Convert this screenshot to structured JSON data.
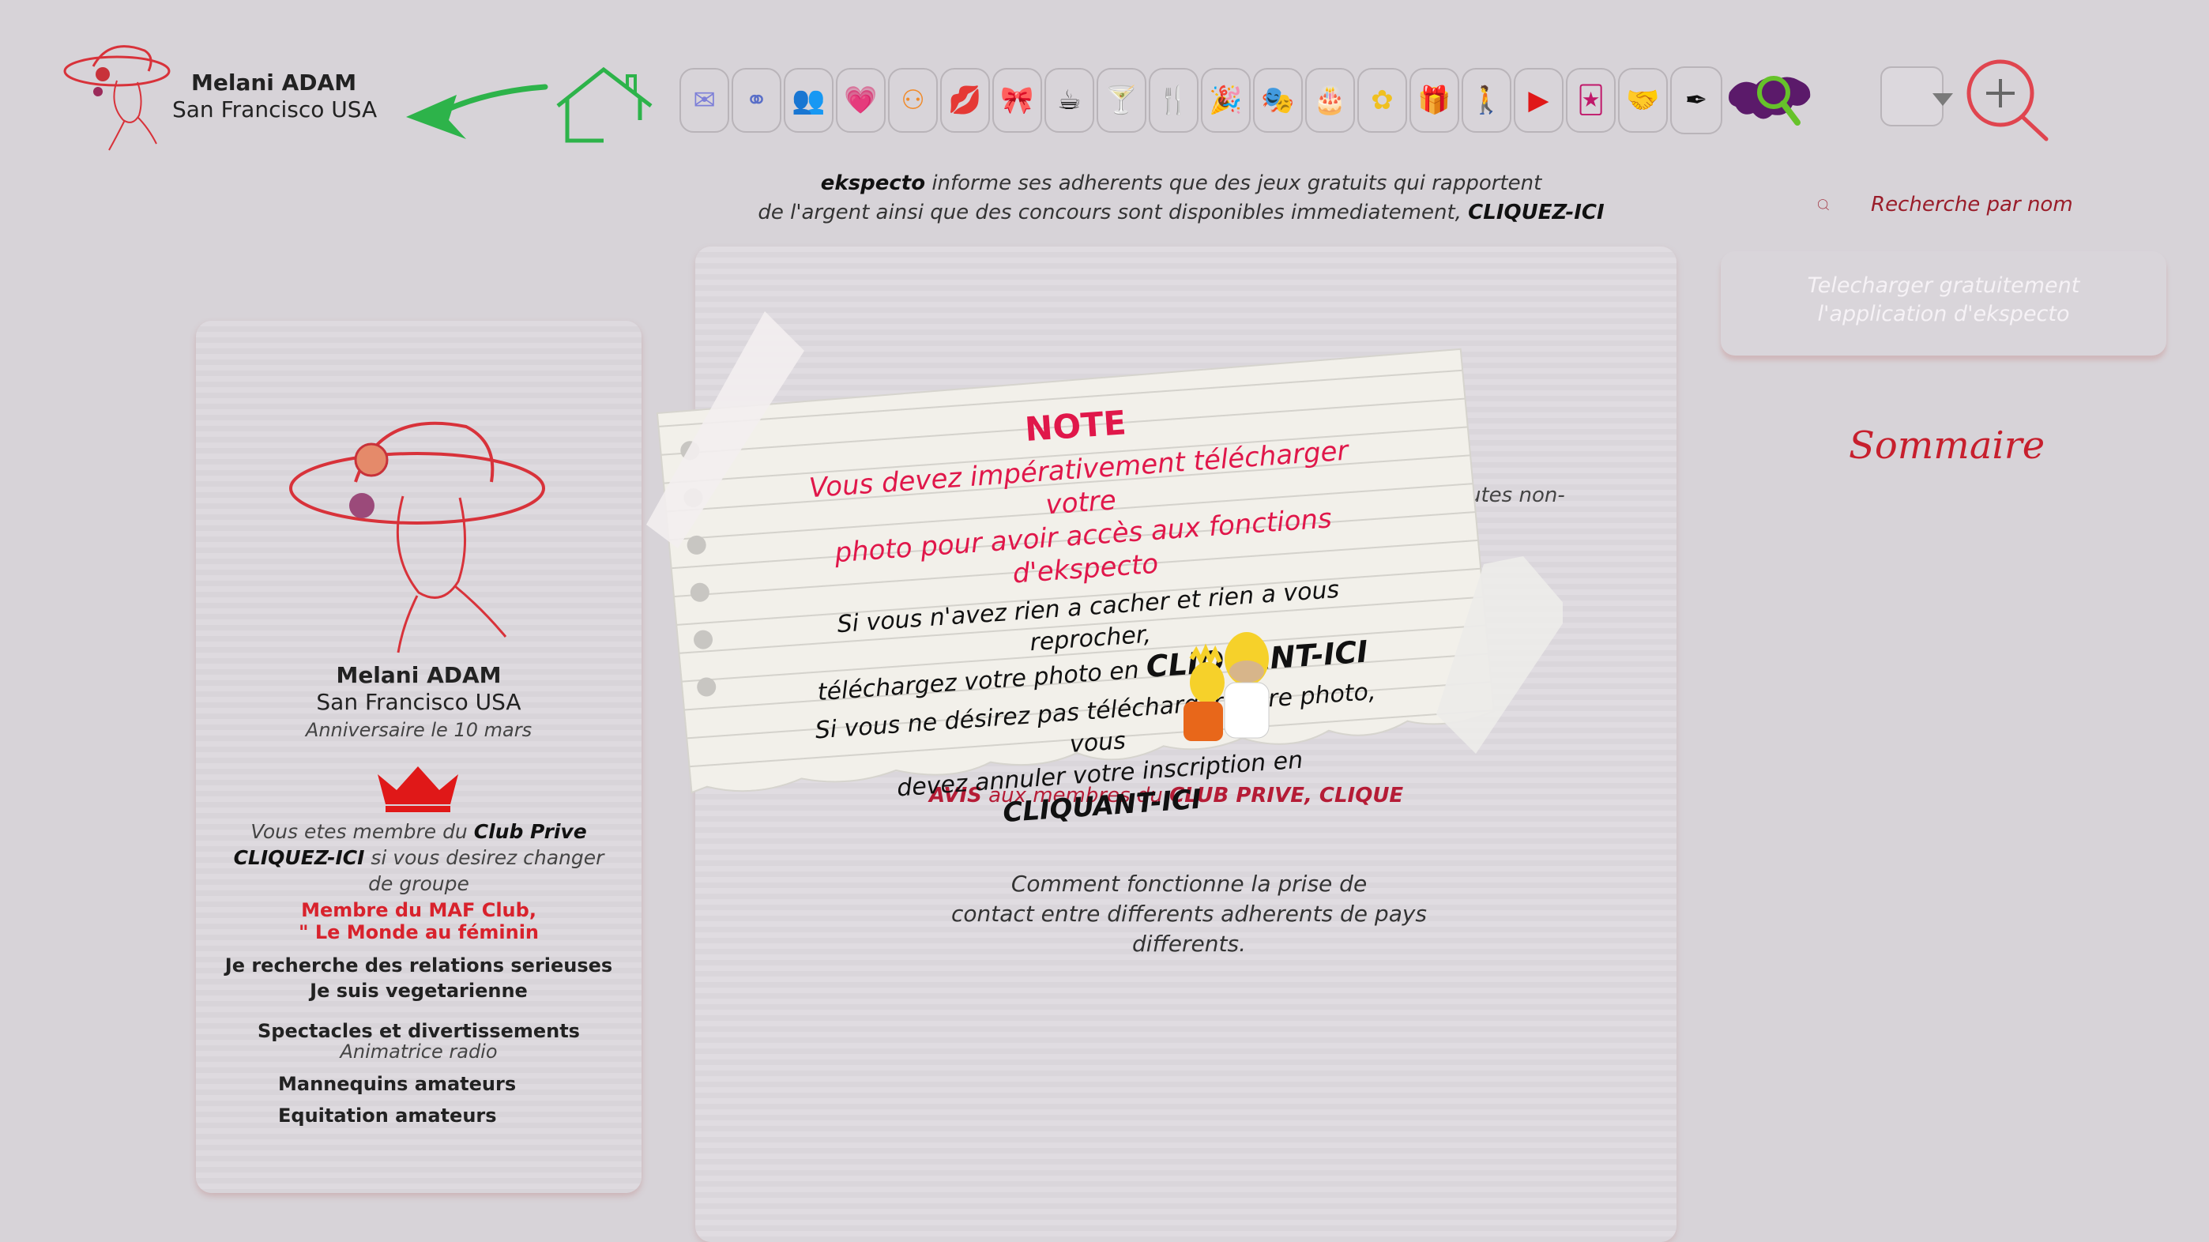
{
  "header": {
    "user_name": "Melani ADAM",
    "user_city": "San Francisco USA"
  },
  "toolbar": {
    "icons": [
      "mail-icon",
      "group-icon",
      "friends-icon",
      "hearts-icon",
      "couple-icon",
      "kiss-icon",
      "bow-icon",
      "coffee-icon",
      "cocktail-icon",
      "restaurant-icon",
      "party-icon",
      "theater-icon",
      "cake-icon",
      "flower-icon",
      "gift-icon",
      "walk-icon",
      "play-icon",
      "jester-icon",
      "handshake-icon",
      "pen-icon",
      "world-search-icon"
    ],
    "select_value": "",
    "accent_color": "#e0454f"
  },
  "info": {
    "brand": "ekspecto",
    "line1": "informe ses adherents que des jeux gratuits qui rapportent",
    "line2": "de l'argent ainsi que des concours sont disponibles  immediatement,",
    "cta": "CLIQUEZ-ICI"
  },
  "search": {
    "label": "Recherche par nom"
  },
  "download": {
    "line1": "Telecharger gratuitement",
    "line2": "l'application d'ekspecto"
  },
  "sommaire": "Sommaire",
  "profile": {
    "name": "Melani ADAM",
    "city": "San Francisco USA",
    "birthday": "Anniversaire le 10 mars",
    "club_pre": "Vous etes membre du",
    "club_name": "Club Prive",
    "club_cta": "CLIQUEZ-ICI",
    "club_post": "si vous desirez changer",
    "club_post2": "de groupe",
    "maf1": "Membre du  MAF Club,",
    "maf2": "\" Le Monde au féminin",
    "relation": "Je recherche des relations serieuses",
    "diet": "Je suis vegetarienne",
    "spectacles": "Spectacles et divertissements",
    "animatrice": "Animatrice radio",
    "mannequins": "Mannequins amateurs",
    "equitation": "Equitation amateurs"
  },
  "main": {
    "behind_text": "utes non-",
    "avis_prefix": "AVIS",
    "avis_mid": "aux membres du",
    "avis_club": "CLUB PRIVE, CLIQUE",
    "comment1": "Comment fonctionne la prise de",
    "comment2": "contact entre differents adherents de pays  differents."
  },
  "note": {
    "title": "NOTE",
    "red1": "Vous devez impérativement télécharger votre",
    "red2": "photo pour avoir accès aux fonctions d'ekspecto",
    "b1": "Si vous n'avez rien a cacher et rien a vous reprocher,",
    "b2": "téléchargez votre photo en",
    "b2_cta": "CLIQUANT-ICI",
    "b3": "Si vous ne désirez pas télécharger votre photo, vous",
    "b4": "devez annuler votre inscription en",
    "b5": "CLIQUANT-ICI"
  }
}
